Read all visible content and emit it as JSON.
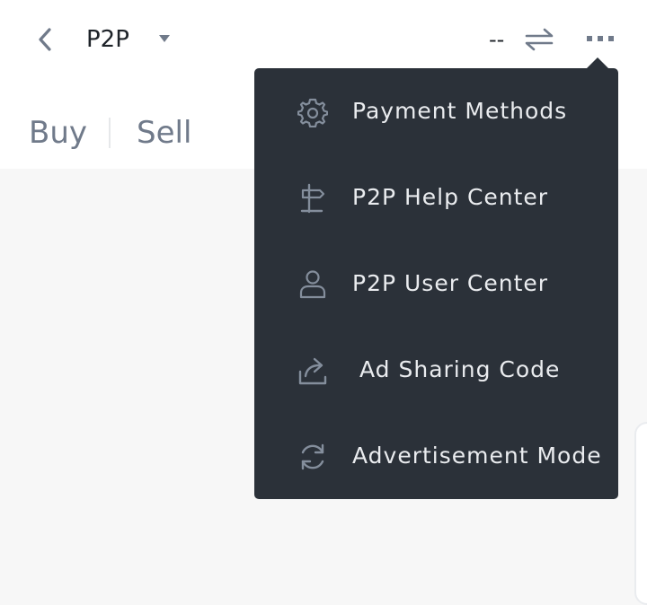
{
  "header": {
    "title": "P2P",
    "price_placeholder": "--"
  },
  "tabs": [
    {
      "label": "Buy"
    },
    {
      "label": "Sell"
    }
  ],
  "menu": {
    "items": [
      {
        "label": "Payment Methods",
        "icon": "gear-icon"
      },
      {
        "label": "P2P Help Center",
        "icon": "signpost-icon"
      },
      {
        "label": "P2P User Center",
        "icon": "user-icon"
      },
      {
        "label": "Ad Sharing Code",
        "icon": "share-icon"
      },
      {
        "label": "Advertisement Mode",
        "icon": "refresh-icon"
      }
    ]
  },
  "colors": {
    "menu_bg": "#2b3139",
    "menu_text": "#eaecef",
    "icon_gray": "#848e9c",
    "tab_text": "#707a8a",
    "title_text": "#1e2329"
  }
}
